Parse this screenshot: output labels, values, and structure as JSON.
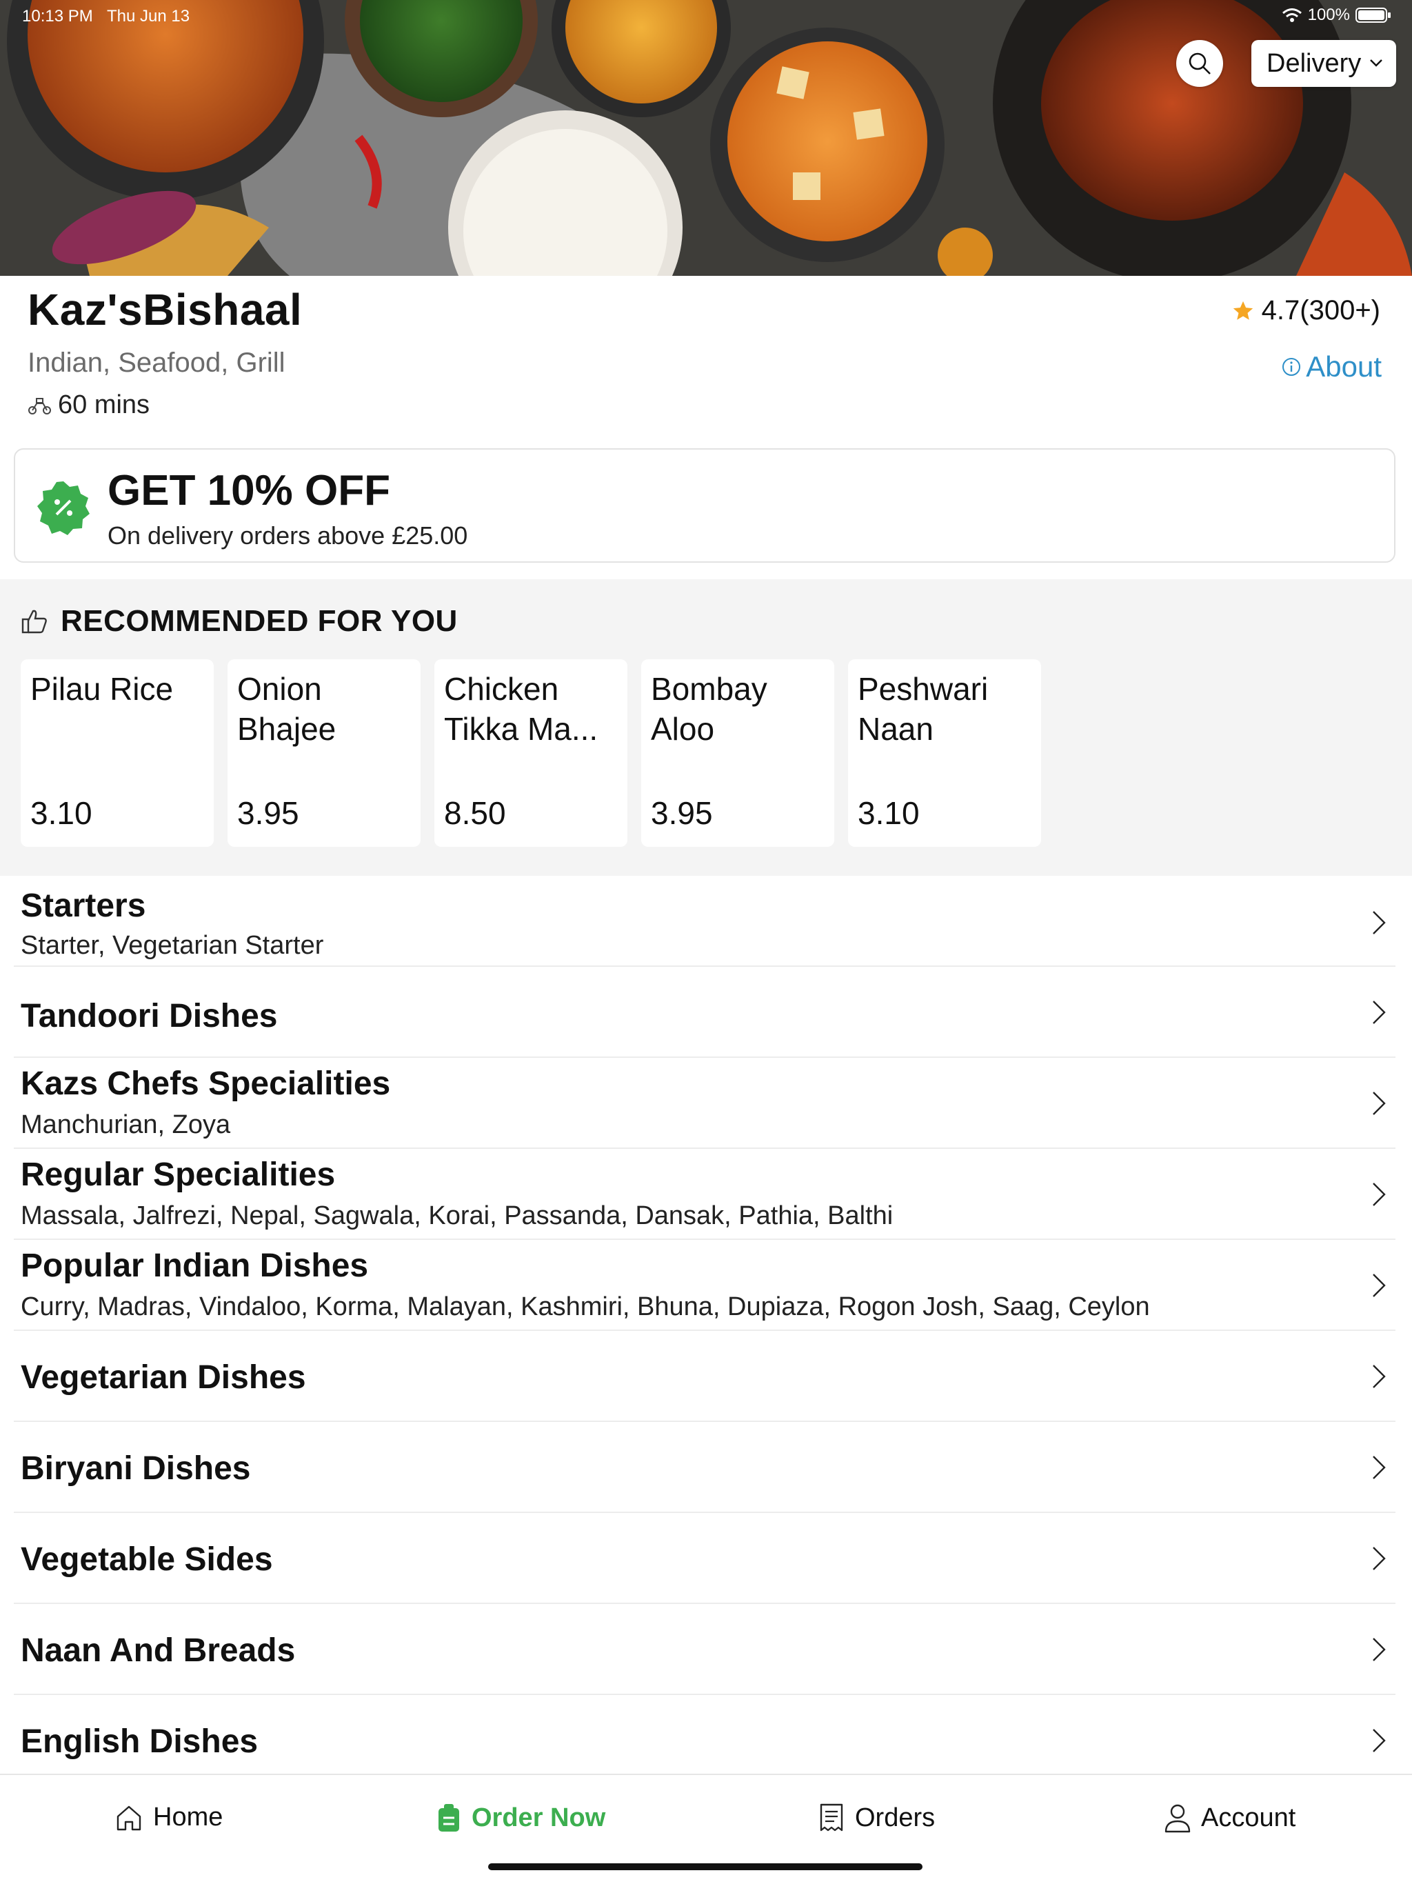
{
  "status_bar": {
    "time": "10:13 PM",
    "date": "Thu Jun 13",
    "battery": "100%"
  },
  "header": {
    "mode": "Delivery",
    "search_icon": "search-icon"
  },
  "restaurant": {
    "name": "Kaz'sBishaal",
    "cuisine": "Indian, Seafood, Grill",
    "delivery_time": "60 mins",
    "rating": "4.7(300+)",
    "about_label": "About"
  },
  "offer": {
    "title": "GET 10% OFF",
    "subtitle": "On delivery orders above £25.00",
    "badge_color": "#3cae4f"
  },
  "recommended": {
    "title": "RECOMMENDED FOR YOU",
    "items": [
      {
        "name": "Pilau Rice",
        "price": "3.10"
      },
      {
        "name": "Onion Bhajee",
        "price": "3.95"
      },
      {
        "name": "Chicken Tikka Ma...",
        "price": "8.50"
      },
      {
        "name": "Bombay Aloo",
        "price": "3.95"
      },
      {
        "name": "Peshwari Naan",
        "price": "3.10"
      }
    ]
  },
  "menu": [
    {
      "title": "Starters",
      "subtitle": "Starter, Vegetarian Starter"
    },
    {
      "title": "Tandoori Dishes",
      "subtitle": ""
    },
    {
      "title": "Kazs Chefs Specialities",
      "subtitle": "Manchurian, Zoya"
    },
    {
      "title": "Regular Specialities",
      "subtitle": "Massala, Jalfrezi, Nepal, Sagwala, Korai, Passanda, Dansak, Pathia, Balthi"
    },
    {
      "title": "Popular Indian Dishes",
      "subtitle": "Curry, Madras, Vindaloo, Korma, Malayan, Kashmiri, Bhuna, Dupiaza, Rogon Josh, Saag, Ceylon"
    },
    {
      "title": "Vegetarian Dishes",
      "subtitle": ""
    },
    {
      "title": "Biryani Dishes",
      "subtitle": ""
    },
    {
      "title": "Vegetable Sides",
      "subtitle": ""
    },
    {
      "title": "Naan And Breads",
      "subtitle": ""
    },
    {
      "title": "English Dishes",
      "subtitle": ""
    }
  ],
  "nav": {
    "home": "Home",
    "order_now": "Order Now",
    "orders": "Orders",
    "account": "Account",
    "active_color": "#3cae4f"
  },
  "colors": {
    "accent_green": "#3cae4f",
    "link_blue": "#2e8fc8",
    "star": "#f5a623"
  }
}
